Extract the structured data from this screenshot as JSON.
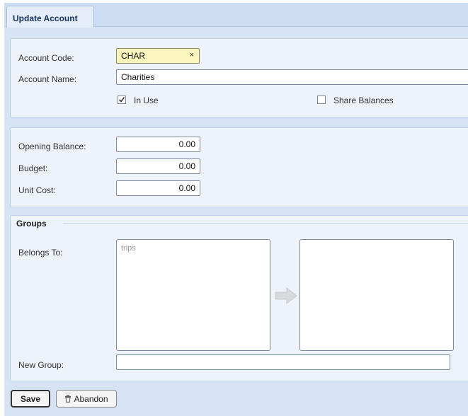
{
  "tabs": [
    {
      "label": "Update Account"
    }
  ],
  "account": {
    "code_label": "Account Code:",
    "code_value": "CHAR",
    "clear_glyph": "×",
    "name_label": "Account Name:",
    "name_value": "Charities",
    "in_use_label": "In Use",
    "in_use_checked": true,
    "share_balances_label": "Share Balances",
    "share_balances_checked": false
  },
  "balances": {
    "opening_label": "Opening Balance:",
    "opening_value": "0.00",
    "budget_label": "Budget:",
    "budget_value": "0.00",
    "unit_cost_label": "Unit Cost:",
    "unit_cost_value": "0.00"
  },
  "groups": {
    "title": "Groups",
    "belongs_label": "Belongs To:",
    "available": [
      "trips"
    ],
    "selected": [],
    "new_group_label": "New Group:",
    "new_group_value": ""
  },
  "actions": {
    "save_label": "Save",
    "abandon_label": "Abandon"
  },
  "icons": {
    "checkmark": "checkmark-icon",
    "clear": "clear-x-icon",
    "move_right": "arrow-right-icon",
    "abandon": "trash-icon"
  },
  "colors": {
    "frame_bg": "#d6e3f5",
    "panel_bg": "#eef3fa",
    "code_field_bg": "#fbf6bd",
    "tab_text": "#15325c"
  }
}
